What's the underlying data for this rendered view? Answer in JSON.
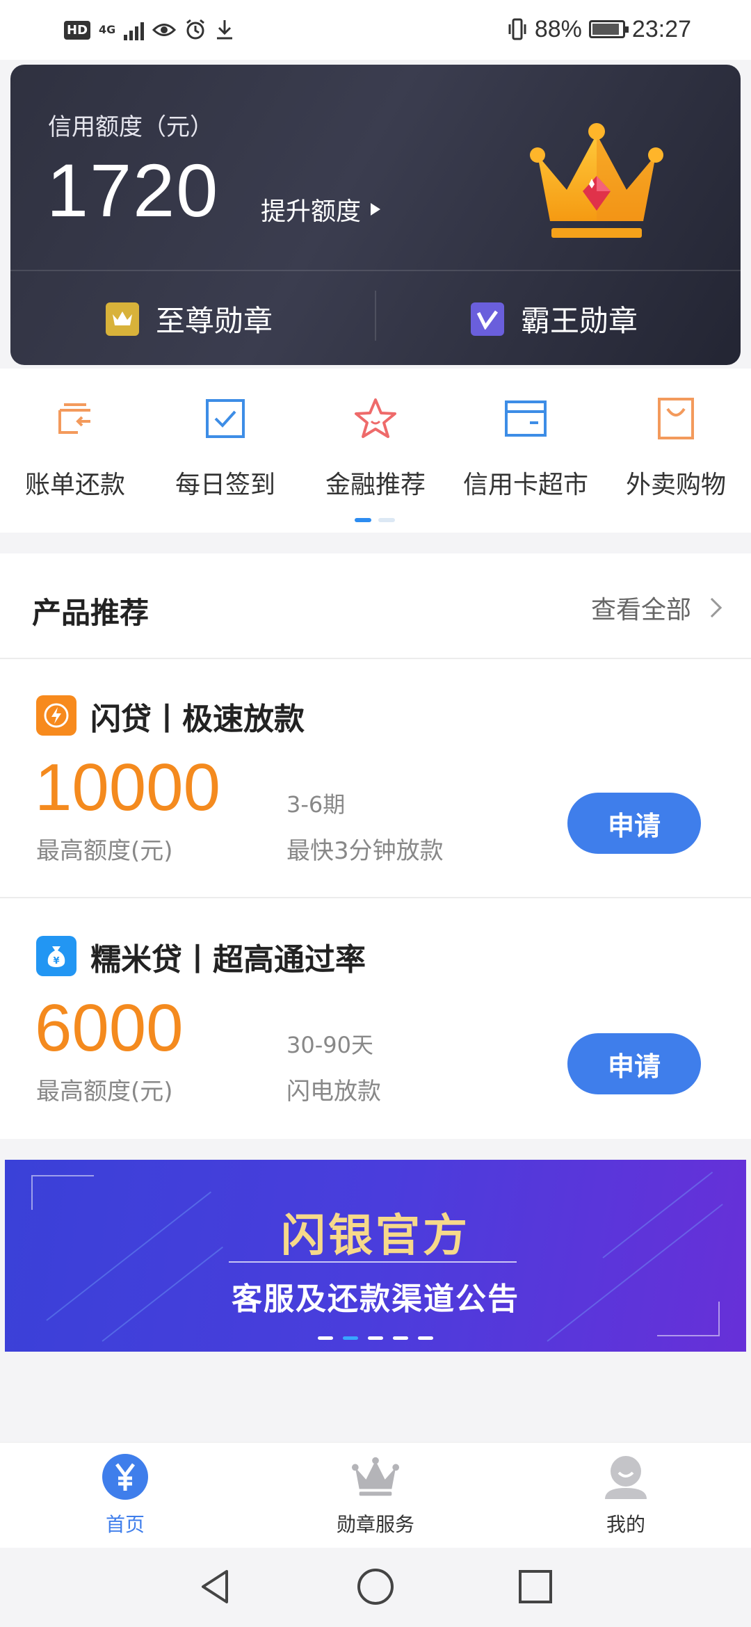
{
  "status_bar": {
    "hd": "HD",
    "network": "4G",
    "battery_percent": "88%",
    "time": "23:27"
  },
  "credit": {
    "label": "信用额度（元）",
    "amount": "1720",
    "raise_label": "提升额度",
    "badges": [
      {
        "label": "至尊勋章",
        "icon": "crown-icon",
        "color": "#d8b23a"
      },
      {
        "label": "霸王勋章",
        "icon": "v-badge-icon",
        "color": "#6a5fdc"
      }
    ]
  },
  "quick_menu": {
    "items": [
      {
        "label": "账单还款",
        "icon": "bill-repay-icon",
        "color": "#f39a5c"
      },
      {
        "label": "每日签到",
        "icon": "checkin-icon",
        "color": "#3d8de6"
      },
      {
        "label": "金融推荐",
        "icon": "star-icon",
        "color": "#ee6a6a"
      },
      {
        "label": "信用卡超市",
        "icon": "card-icon",
        "color": "#3d8de6"
      },
      {
        "label": "外卖购物",
        "icon": "shopping-bag-icon",
        "color": "#f39a5c"
      }
    ],
    "active_page": 1,
    "page_count": 2
  },
  "products": {
    "title": "产品推荐",
    "view_all": "查看全部",
    "items": [
      {
        "name": "闪贷丨极速放款",
        "amount": "10000",
        "amount_label": "最高额度(元)",
        "term": "3-6期",
        "desc": "最快3分钟放款",
        "button": "申请",
        "logo_icon": "lightning-icon",
        "logo_color": "#f78a1d"
      },
      {
        "name": "糯米贷丨超高通过率",
        "amount": "6000",
        "amount_label": "最高额度(元)",
        "term": "30-90天",
        "desc": "闪电放款",
        "button": "申请",
        "logo_icon": "money-bag-icon",
        "logo_color": "#2296f3"
      }
    ]
  },
  "banner": {
    "title": "闪银官方",
    "subtitle": "客服及还款渠道公告",
    "active_slide": 2,
    "slide_count": 5
  },
  "tab_bar": {
    "tabs": [
      {
        "label": "首页",
        "icon": "home-yen-icon",
        "active": true
      },
      {
        "label": "勋章服务",
        "icon": "crown-icon",
        "active": false
      },
      {
        "label": "我的",
        "icon": "user-icon",
        "active": false
      }
    ]
  },
  "colors": {
    "accent": "#3f7eeb",
    "amount": "#f48a1e",
    "card_bg": "#2f3140"
  }
}
